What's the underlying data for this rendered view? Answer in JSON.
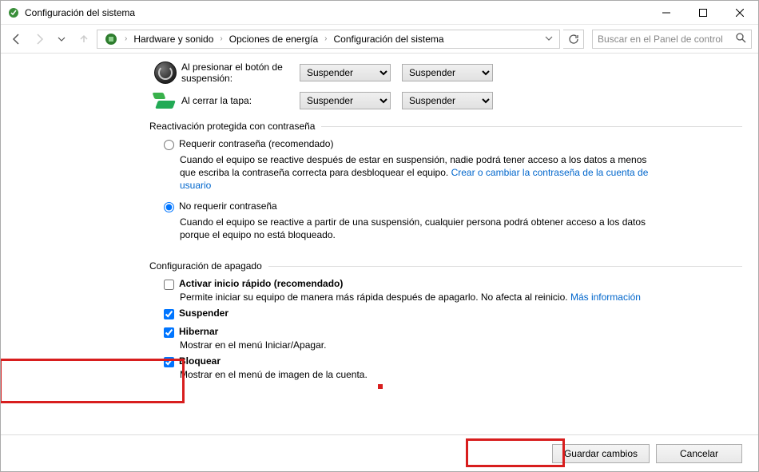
{
  "window": {
    "title": "Configuración del sistema"
  },
  "breadcrumb": {
    "items": [
      "Hardware y sonido",
      "Opciones de energía",
      "Configuración del sistema"
    ]
  },
  "search": {
    "placeholder": "Buscar en el Panel de control"
  },
  "actions": {
    "power_button": {
      "label": "Al presionar el botón de suspensión:",
      "col1": "Suspender",
      "col2": "Suspender"
    },
    "close_lid": {
      "label": "Al cerrar la tapa:",
      "col1": "Suspender",
      "col2": "Suspender"
    }
  },
  "password_section": {
    "title": "Reactivación protegida con contraseña",
    "require": {
      "label": "Requerir contraseña (recomendado)",
      "desc_pre": "Cuando el equipo se reactive después de estar en suspensión, nadie podrá tener acceso a los datos a menos que escriba la contraseña correcta para desbloquear el equipo. ",
      "link": "Crear o cambiar la contraseña de la cuenta de usuario"
    },
    "norequire": {
      "label": "No requerir contraseña",
      "desc": "Cuando el equipo se reactive a partir de una suspensión, cualquier persona podrá obtener acceso a los datos porque el equipo no está bloqueado."
    }
  },
  "shutdown_section": {
    "title": "Configuración de apagado",
    "fast_startup": {
      "checked": false,
      "label": "Activar inicio rápido (recomendado)",
      "desc_pre": "Permite iniciar su equipo de manera más rápida después de apagarlo. No afecta al reinicio. ",
      "link": "Más información"
    },
    "suspend": {
      "checked": true,
      "label": "Suspender"
    },
    "hibernate": {
      "checked": true,
      "label": "Hibernar",
      "desc": "Mostrar en el menú Iniciar/Apagar."
    },
    "lock": {
      "checked": true,
      "label": "Bloquear",
      "desc": "Mostrar en el menú de imagen de la cuenta."
    }
  },
  "footer": {
    "save": "Guardar cambios",
    "cancel": "Cancelar"
  }
}
